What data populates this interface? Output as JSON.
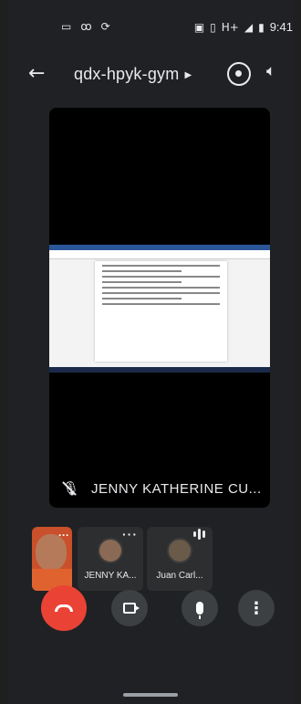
{
  "status_bar": {
    "left_icons": [
      "video-icon",
      "voicemail-icon",
      "sync-icon"
    ],
    "right_icons": [
      "nfc-icon",
      "vibrate-icon",
      "signal-icon",
      "battery-icon"
    ],
    "network": "H+",
    "time": "9:41"
  },
  "app_bar": {
    "meeting_code": "qdx-hpyk-gym",
    "back_icon": "arrow-back-icon",
    "switch_camera_icon": "switch-camera-icon",
    "speaker_icon": "volume-icon"
  },
  "main_tile": {
    "content": "screen-share",
    "muted": true,
    "presenter_name": "JENNY KATHERINE CU..."
  },
  "participants": [
    {
      "name": "",
      "is_self": true,
      "more_icon": "more-horiz-icon"
    },
    {
      "name": "JENNY KA...",
      "more_icon": "more-horiz-icon"
    },
    {
      "name": "Juan Carl...",
      "speaking_icon": "audio-level-icon"
    }
  ],
  "controls": {
    "hangup_icon": "call-end-icon",
    "camera_icon": "videocam-icon",
    "mic_icon": "mic-icon",
    "more_icon": "more-vert-icon",
    "hangup_color": "#ea4335"
  },
  "colors": {
    "background": "#202124",
    "tile": "#2d2e30",
    "control_button": "#3c4043"
  }
}
